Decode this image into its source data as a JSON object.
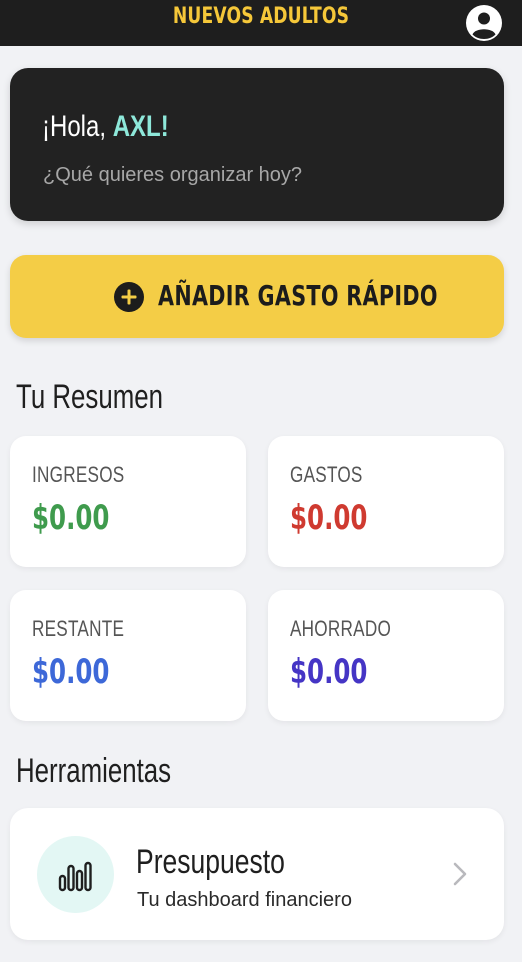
{
  "header": {
    "title": "NUEVOS ADULTOS",
    "user_icon": "user-circle-icon"
  },
  "greeting": {
    "hello": "¡Hola,",
    "name": "AXL!",
    "prompt": "¿Qué quieres organizar hoy?"
  },
  "quick_add": {
    "icon": "plus-circle-icon",
    "label": "AÑADIR GASTO RÁPIDO"
  },
  "summary": {
    "title": "Tu Resumen",
    "cards": [
      {
        "label": "INGRESOS",
        "value": "$0.00",
        "color": "#3f9b4d"
      },
      {
        "label": "GASTOS",
        "value": "$0.00",
        "color": "#cf3a30"
      },
      {
        "label": "RESTANTE",
        "value": "$0.00",
        "color": "#3d68d8"
      },
      {
        "label": "AHORRADO",
        "value": "$0.00",
        "color": "#4535c5"
      }
    ]
  },
  "tools": {
    "title": "Herramientas",
    "items": [
      {
        "icon": "bar-chart-icon",
        "title": "Presupuesto",
        "subtitle": "Tu dashboard financiero",
        "arrow": "chevron-right-icon"
      }
    ]
  },
  "colors": {
    "header_bg": "#1e1e1e",
    "brand": "#f5c739",
    "accent_teal": "#8ee8da",
    "button_yellow": "#f4cd46",
    "page_bg": "#f1f2f5"
  }
}
